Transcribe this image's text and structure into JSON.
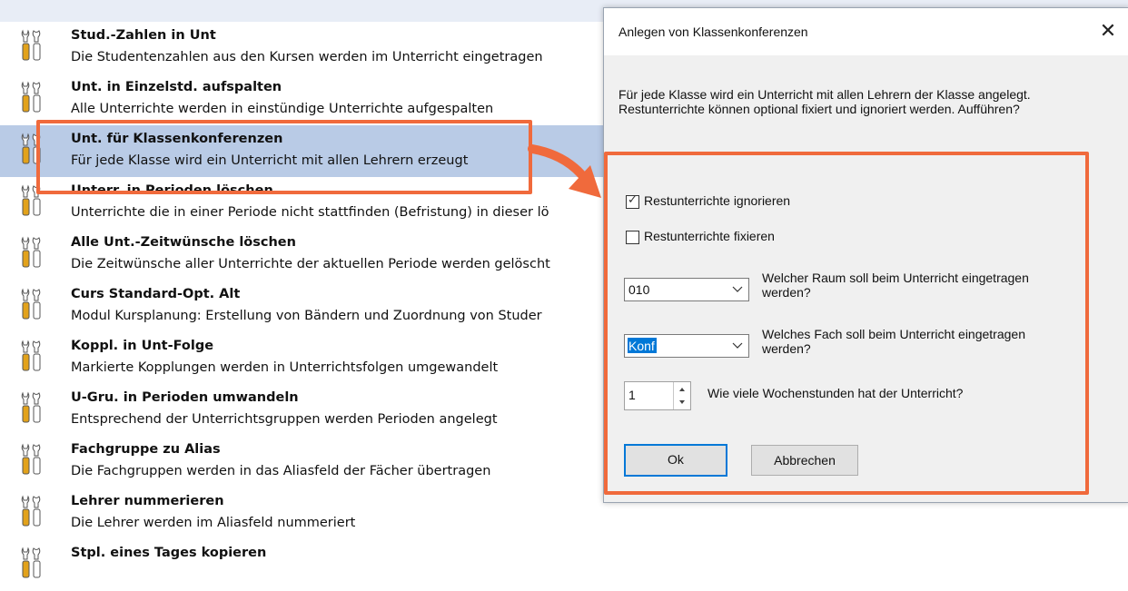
{
  "list": {
    "items": [
      {
        "title": "Stud.-Zahlen in Unt",
        "desc": "Die Studentenzahlen aus den Kursen werden im Unterricht eingetragen"
      },
      {
        "title": "Unt. in Einzelstd. aufspalten",
        "desc": "Alle Unterrichte werden in einstündige Unterrichte aufgespalten"
      },
      {
        "title": "Unt. für Klassenkonferenzen",
        "desc": "Für jede Klasse wird ein Unterricht mit allen Lehrern erzeugt"
      },
      {
        "title": "Unterr. in Perioden löschen",
        "desc": "Unterrichte die in einer Periode nicht stattfinden (Befristung) in dieser lö"
      },
      {
        "title": "Alle Unt.-Zeitwünsche löschen",
        "desc": "Die Zeitwünsche aller Unterrichte der aktuellen Periode werden gelöscht"
      },
      {
        "title": "Curs Standard-Opt. Alt",
        "desc": "Modul Kursplanung: Erstellung von Bändern und Zuordnung von Studer"
      },
      {
        "title": "Koppl. in Unt-Folge",
        "desc": "Markierte Kopplungen werden in Unterrichtsfolgen umgewandelt"
      },
      {
        "title": "U-Gru. in Perioden umwandeln",
        "desc": "Entsprechend der Unterrichtsgruppen werden Perioden angelegt"
      },
      {
        "title": "Fachgruppe zu Alias",
        "desc": "Die Fachgruppen werden in das Aliasfeld der Fächer übertragen"
      },
      {
        "title": "Lehrer nummerieren",
        "desc": "Die Lehrer werden im Aliasfeld nummeriert"
      },
      {
        "title": "Stpl. eines Tages kopieren",
        "desc": ""
      }
    ],
    "selected_index": 2
  },
  "dialog": {
    "title": "Anlegen von Klassenkonferenzen",
    "message_line1": "Für jede Klasse wird ein Unterricht mit allen Lehrern der Klasse angelegt.",
    "message_line2": "Restunterrichte können optional fixiert und ignoriert werden. Aufführen?",
    "checkbox_ignore": {
      "label": "Restunterrichte ignorieren",
      "checked": true
    },
    "checkbox_fix": {
      "label": "Restunterrichte fixieren",
      "checked": false
    },
    "room": {
      "value": "010",
      "question_line1": "Welcher Raum soll beim Unterricht eingetragen",
      "question_line2": "werden?"
    },
    "subject": {
      "value": "Konf",
      "question_line1": "Welches Fach soll beim Unterricht eingetragen",
      "question_line2": "werden?"
    },
    "hours": {
      "value": "1",
      "question": "Wie viele Wochenstunden hat der Unterricht?"
    },
    "ok_label": "Ok",
    "cancel_label": "Abbrechen"
  },
  "icons": {
    "list_item": "tools-wrench-screwdriver-icon",
    "close": "close-icon",
    "dropdown": "chevron-down-icon",
    "callout": "callout-arrow"
  },
  "colors": {
    "highlight": "#f06a3c",
    "selection": "#b9cbe6",
    "accent": "#0078d7"
  }
}
